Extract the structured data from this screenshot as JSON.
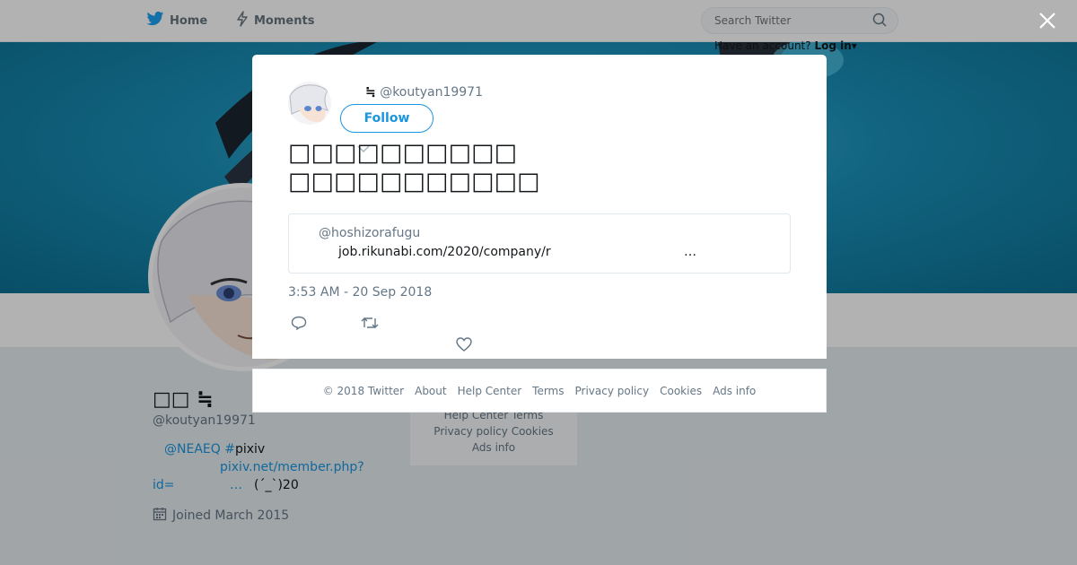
{
  "topbar": {
    "home_label": "Home",
    "moments_label": "Moments",
    "search_placeholder": "Search Twitter",
    "login_prompt": "Have an account?",
    "login_label": "Log in"
  },
  "profile": {
    "name_symbol": "≒",
    "handle": "@koutyan19971",
    "bio_mention": "@NEAEQ",
    "bio_hashtag_symbol": "#",
    "bio_hashtag_text": "pixiv",
    "bio_link": "pixiv.net/member.php?",
    "bio_id_prefix": "id=",
    "bio_ellipsis": "…",
    "bio_emote": "(´_`)20",
    "joined": "Joined March 2015"
  },
  "side_card": {
    "line1": "Help Center   Terms",
    "line2": "Privacy policy   Cookies",
    "line3": "Ads info"
  },
  "tweet": {
    "author_symbol": "≒",
    "author_handle": "@koutyan19971",
    "follow_label": "Follow",
    "text_line1": "□□□□□□□□□□",
    "text_line2": "□□□□□□□□□□□",
    "quote_handle": "@hoshizorafugu",
    "quote_link": "job.rikunabi.com/2020/company/r",
    "quote_ellipsis": "…",
    "timestamp": "3:53 AM - 20 Sep 2018"
  },
  "footer": {
    "copyright": "© 2018 Twitter",
    "about": "About",
    "help": "Help Center",
    "terms": "Terms",
    "privacy": "Privacy policy",
    "cookies": "Cookies",
    "ads": "Ads info"
  },
  "colors": {
    "brand_blue": "#1da1f2",
    "link_blue": "#1b95e0",
    "muted_gray": "#657786"
  }
}
